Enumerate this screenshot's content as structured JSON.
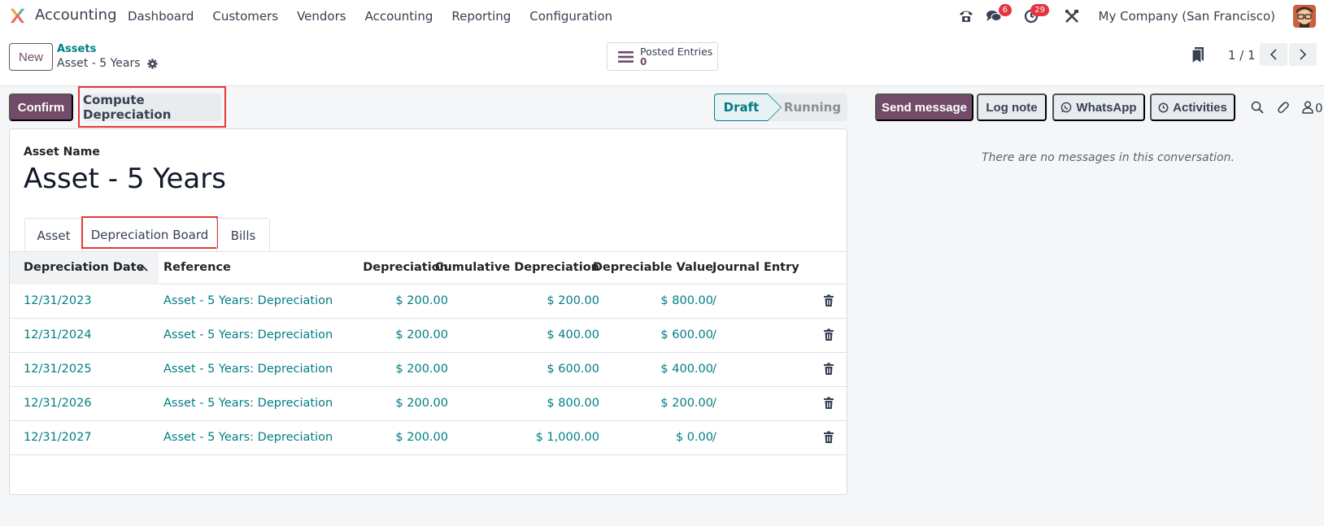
{
  "navbar": {
    "app_name": "Accounting",
    "menu": [
      "Dashboard",
      "Customers",
      "Vendors",
      "Accounting",
      "Reporting",
      "Configuration"
    ],
    "messages_badge": "6",
    "activities_badge": "29",
    "company": "My Company (San Francisco)"
  },
  "control": {
    "new_label": "New",
    "breadcrumb_parent": "Assets",
    "breadcrumb_current": "Asset - 5 Years",
    "smart_label": "Posted Entries",
    "smart_value": "0",
    "pager": "1 / 1"
  },
  "statusbar": {
    "confirm_label": "Confirm",
    "compute_label": "Compute Depreciation",
    "stage_draft": "Draft",
    "stage_running": "Running"
  },
  "form": {
    "name_label": "Asset Name",
    "name_value": "Asset - 5 Years",
    "tabs": [
      "Asset",
      "Depreciation Board",
      "Bills"
    ],
    "columns": [
      "Depreciation Date",
      "Reference",
      "Depreciation",
      "Cumulative Depreciation",
      "Depreciable Value",
      "Journal Entry"
    ],
    "rows": [
      {
        "date": "12/31/2023",
        "ref": "Asset - 5 Years: Depreciation",
        "dep": "$ 200.00",
        "cum": "$ 200.00",
        "val": "$ 800.00",
        "je": "/"
      },
      {
        "date": "12/31/2024",
        "ref": "Asset - 5 Years: Depreciation",
        "dep": "$ 200.00",
        "cum": "$ 400.00",
        "val": "$ 600.00",
        "je": "/"
      },
      {
        "date": "12/31/2025",
        "ref": "Asset - 5 Years: Depreciation",
        "dep": "$ 200.00",
        "cum": "$ 600.00",
        "val": "$ 400.00",
        "je": "/"
      },
      {
        "date": "12/31/2026",
        "ref": "Asset - 5 Years: Depreciation",
        "dep": "$ 200.00",
        "cum": "$ 800.00",
        "val": "$ 200.00",
        "je": "/"
      },
      {
        "date": "12/31/2027",
        "ref": "Asset - 5 Years: Depreciation",
        "dep": "$ 200.00",
        "cum": "$ 1,000.00",
        "val": "$ 0.00",
        "je": "/"
      }
    ]
  },
  "chatter": {
    "send_label": "Send message",
    "log_label": "Log note",
    "whatsapp_label": "WhatsApp",
    "activities_label": "Activities",
    "followers_count": "0",
    "empty_text": "There are no messages in this conversation."
  },
  "colors": {
    "brand": "#714b67",
    "link": "#017e84",
    "highlight": "#e53935"
  },
  "icons": [
    "app-logo-icon",
    "phone-icon",
    "chat-bubble-icon",
    "clock-icon",
    "tools-icon",
    "gear-icon",
    "list-icon",
    "bookmark-icon",
    "chevron-left-icon",
    "chevron-right-icon",
    "sort-up-icon",
    "trash-icon",
    "whatsapp-icon",
    "search-icon",
    "paperclip-icon",
    "user-icon"
  ]
}
